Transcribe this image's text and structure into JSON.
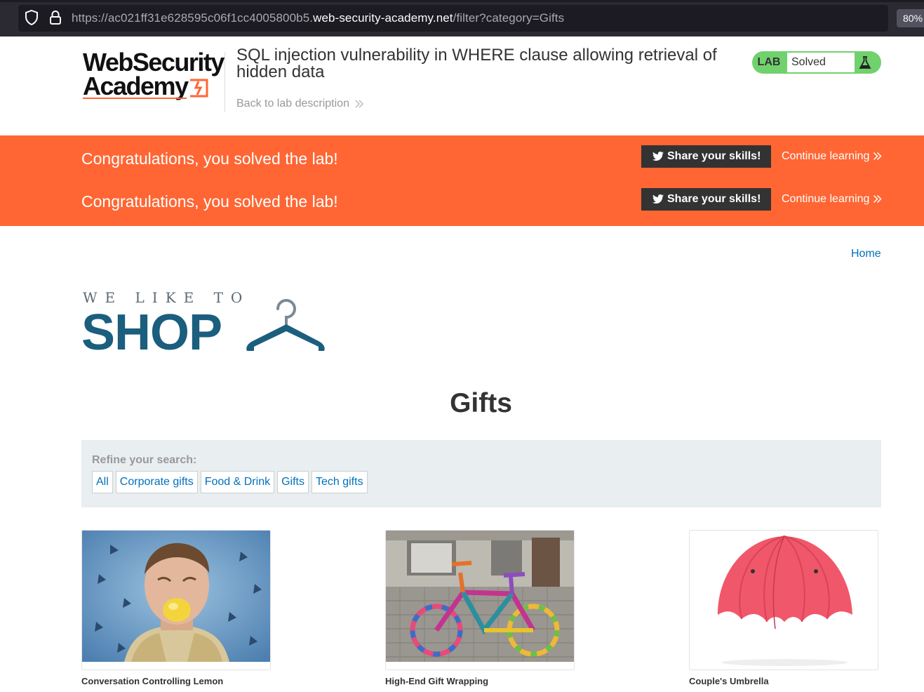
{
  "browser": {
    "url_scheme_prefix": "https://ac021ff31e628595c06f1cc4005800b5.",
    "url_host": "web-security-academy.net",
    "url_path": "/filter?category=Gifts",
    "zoom": "80%"
  },
  "academy": {
    "logo_line1": "WebSecurity",
    "logo_line2": "Academy",
    "lab_title": "SQL injection vulnerability in WHERE clause allowing retrieval of hidden data",
    "back_link": "Back to lab description",
    "status_label": "LAB",
    "status_value": "Solved"
  },
  "banner": {
    "rows": [
      {
        "message": "Congratulations, you solved the lab!",
        "share": "Share your skills!",
        "continue": "Continue learning"
      },
      {
        "message": "Congratulations, you solved the lab!",
        "share": "Share your skills!",
        "continue": "Continue learning"
      }
    ]
  },
  "shop": {
    "home_link": "Home",
    "logo_tagline": "WE LIKE TO",
    "logo_word": "SHOP",
    "heading": "Gifts",
    "refine_label": "Refine your search:",
    "filters": [
      "All",
      "Corporate gifts",
      "Food & Drink",
      "Gifts",
      "Tech gifts"
    ],
    "products": [
      {
        "name": "Conversation Controlling Lemon"
      },
      {
        "name": "High-End Gift Wrapping"
      },
      {
        "name": "Couple's Umbrella"
      }
    ]
  },
  "colors": {
    "brand_orange": "#ff6633",
    "solved_green": "#70d16d",
    "link_blue": "#0071bc",
    "shop_blue": "#1b5e7e"
  },
  "icons": [
    "shield-icon",
    "lock-icon",
    "chevron-right-icon",
    "flask-icon",
    "twitter-bird-icon",
    "hanger-icon"
  ]
}
